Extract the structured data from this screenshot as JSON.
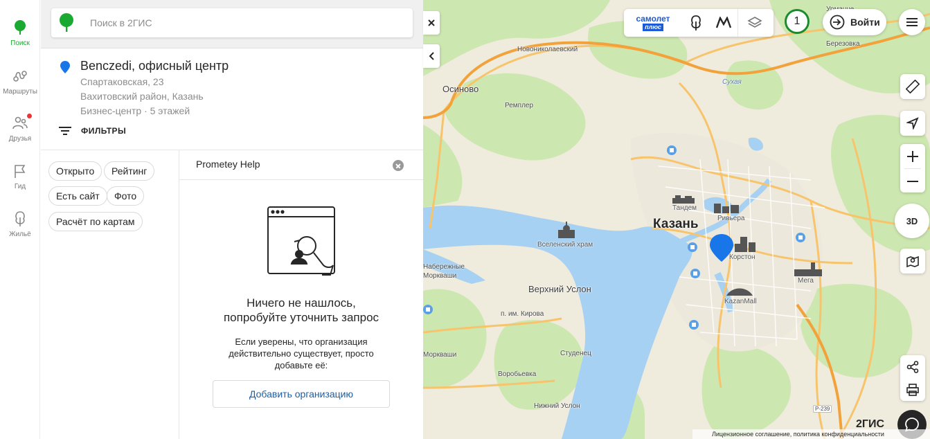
{
  "rail": [
    {
      "label": "Поиск",
      "icon": "search-leaf-icon"
    },
    {
      "label": "Маршруты",
      "icon": "routes-icon"
    },
    {
      "label": "Друзья",
      "icon": "friends-icon"
    },
    {
      "label": "Гид",
      "icon": "flag-icon"
    },
    {
      "label": "Жильё",
      "icon": "housing-icon"
    }
  ],
  "search": {
    "placeholder": "Поиск в 2ГИС",
    "value": ""
  },
  "result": {
    "title": "Benczedi, офисный центр",
    "address": "Спартаковская, 23",
    "district": "Вахитовский район, Казань",
    "info": "Бизнес-центр · 5 этажей"
  },
  "filters_label": "ФИЛЬТРЫ",
  "chips": [
    "Открыто",
    "Рейтинг",
    "Есть сайт",
    "Фото",
    "Расчёт по картам"
  ],
  "query": "Prometey Help",
  "empty": {
    "title_line1": "Ничего не нашлось,",
    "title_line2": "попробуйте уточнить запрос",
    "desc": "Если уверены, что организация действительно существует, просто добавьте её:",
    "button": "Добавить организацию"
  },
  "toolbar": {
    "samolet": "самолет",
    "plus": "плюс"
  },
  "notifications": "1",
  "login": "Войти",
  "zoom_in": "+",
  "zoom_out": "−",
  "btn3d": "3D",
  "brand": "2ГИС",
  "legal": "Лицензионное соглашение, политика конфиденциальности",
  "colors": {
    "brand_green": "#1baa31",
    "pin_blue": "#1976e8",
    "water": "#a7d1f2",
    "park": "#cde7b0",
    "road": "#f7c46b"
  },
  "map_labels": {
    "urmanche": "Урманче",
    "berezovka": "Березовка",
    "novonikolaevsky": "Новониколаевский",
    "osinovo": "Осиново",
    "sukaya": "Сухая",
    "remplér": "Ремплер",
    "tandem": "Тандем",
    "riviera": "Ривьера",
    "kazan": "Казань",
    "korston": "Корстон",
    "vselensky": "Вселенский храм",
    "naberezhnye": "Набережные",
    "morkvashi1": "Моркваши",
    "verkhny_uslon": "Верхний Услон",
    "mega": "Мега",
    "kazanmall": "KazanMall",
    "kirova": "п. им. Кирова",
    "morkvashi2": "Моркваши",
    "studenets": "Студенец",
    "vorobyovka": "Воробьевка",
    "nizhny_uslon": "Нижний Услон",
    "r239": "Р-239"
  }
}
